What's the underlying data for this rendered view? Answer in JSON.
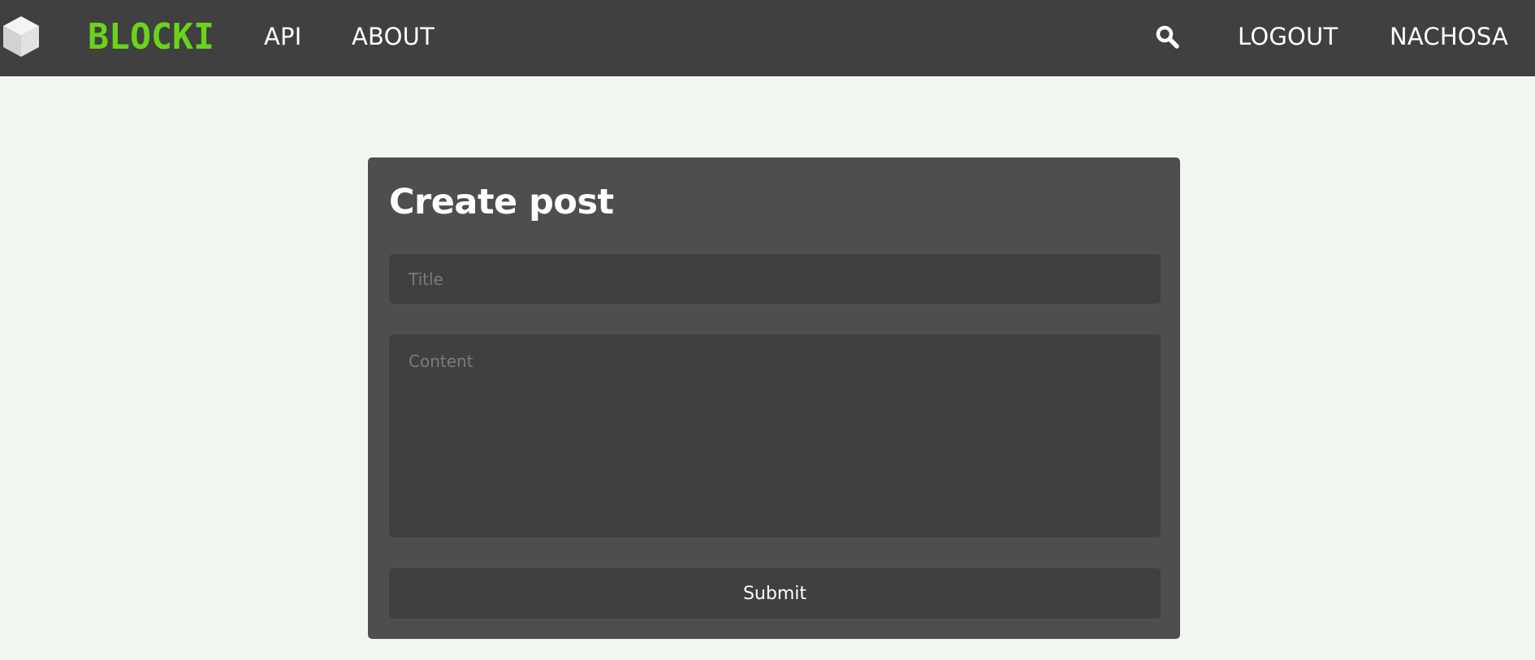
{
  "navbar": {
    "brand": "BLOCKI",
    "links": [
      {
        "label": "API"
      },
      {
        "label": "ABOUT"
      }
    ],
    "search_icon": "search-icon",
    "logout_label": "LOGOUT",
    "username": "NACHOSA"
  },
  "form": {
    "heading": "Create post",
    "title_placeholder": "Title",
    "title_value": "",
    "content_placeholder": "Content",
    "content_value": "",
    "submit_label": "Submit"
  },
  "colors": {
    "navbar_bg": "#404040",
    "page_bg": "#f1f6ee",
    "card_bg": "#4e4e4e",
    "field_bg": "#404040",
    "brand_green": "#6ad31a",
    "text": "#ffffff",
    "placeholder": "#7a7a7a"
  }
}
